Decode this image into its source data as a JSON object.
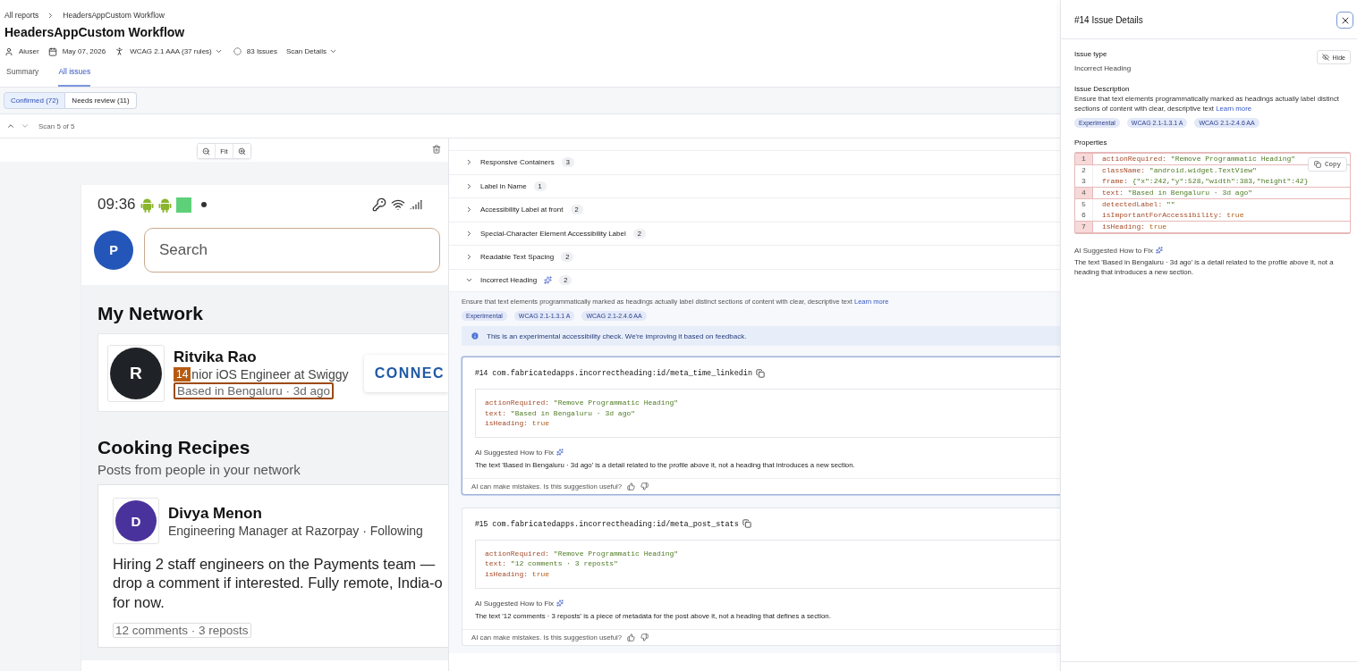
{
  "breadcrumb": [
    {
      "label": "All reports"
    },
    {
      "label": "HeadersAppCustom Workflow"
    }
  ],
  "title": "HeadersAppCustom Workflow",
  "meta": {
    "user": "Aiuser",
    "date": "May 07, 2026",
    "standard": "WCAG 2.1 AAA (37 rules)",
    "issues": "83 Issues",
    "scan_details": "Scan Details"
  },
  "tabs": [
    {
      "label": "Summary",
      "selected": false
    },
    {
      "label": "All issues",
      "selected": true
    }
  ],
  "filters": [
    {
      "label": "Confirmed (72)",
      "selected": true
    },
    {
      "label": "Needs review (11)",
      "selected": false
    }
  ],
  "scan": "Scan 5 of 5",
  "preview": {
    "fit": "Fit",
    "phone": {
      "time": "09:36",
      "avatar": "P",
      "search_placeholder": "Search",
      "network": {
        "heading": "My Network",
        "initial": "R",
        "name": "Ritvika Rao",
        "badge": "14",
        "headline": "nior iOS Engineer at Swiggy",
        "meta": "Based in Bengaluru · 3d ago",
        "highlighted": true,
        "button": "CONNEC"
      },
      "feed": {
        "heading": "Cooking Recipes",
        "subtitle": "Posts from people in your network",
        "initial": "D",
        "name": "Divya Menon",
        "headline": "Engineering Manager at Razorpay · Following",
        "body": "Hiring 2 staff engineers on the Payments team —\ndrop a comment if interested. Fully remote, India-o\nfor now.",
        "stats": "12 comments · 3 reposts",
        "highlighted": false
      }
    }
  },
  "issue_list": {
    "categories": [
      {
        "label": "Responsive Containers",
        "count": "3",
        "expanded": false,
        "ai": false
      },
      {
        "label": "Label in Name",
        "count": "1",
        "expanded": false,
        "ai": false
      },
      {
        "label": "Accessibility Label at front",
        "count": "2",
        "expanded": false,
        "ai": false
      },
      {
        "label": "Special-Character Element Accessibility Label",
        "count": "2",
        "expanded": false,
        "ai": false
      },
      {
        "label": "Readable Text Spacing",
        "count": "2",
        "expanded": false,
        "ai": false
      },
      {
        "label": "Incorrect Heading",
        "count": "2",
        "expanded": true,
        "ai": true
      }
    ],
    "detail": {
      "description": "Ensure that text elements programmatically marked as headings actually label distinct sections of content with clear, descriptive text",
      "learn_more": "Learn more",
      "tags": [
        "Experimental",
        "WCAG 2.1-1.3.1 A",
        "WCAG 2.1-2.4.6 AA"
      ],
      "notice": "This is an experimental accessibility check. We're improving it based on feedback.",
      "issues": [
        {
          "number": "#14",
          "id": "com.fabricatedapps.incorrectheading:id/meta_time_linkedin",
          "selected": true,
          "properties": [
            {
              "key": "actionRequired:",
              "value": "\"Remove Programmatic Heading\"",
              "kind": "string"
            },
            {
              "key": "text:",
              "value": "\"Based in Bengaluru · 3d ago\"",
              "kind": "string"
            },
            {
              "key": "isHeading:",
              "value": "true",
              "kind": "literal"
            }
          ],
          "fix_label": "AI Suggested How to Fix",
          "fix": "The text 'Based in Bengaluru · 3d ago' is a detail related to the profile above it, not a heading that introduces a new section.",
          "feedback": "AI can make mistakes. Is this suggestion useful?"
        },
        {
          "number": "#15",
          "id": "com.fabricatedapps.incorrectheading:id/meta_post_stats",
          "selected": false,
          "properties": [
            {
              "key": "actionRequired:",
              "value": "\"Remove Programmatic Heading\"",
              "kind": "string"
            },
            {
              "key": "text:",
              "value": "\"12 comments · 3 reposts\"",
              "kind": "string"
            },
            {
              "key": "isHeading:",
              "value": "true",
              "kind": "literal"
            }
          ],
          "fix_label": "AI Suggested How to Fix",
          "fix": "The text '12 comments · 3 reposts' is a piece of metadata for the post above it, not a heading that defines a section.",
          "feedback": "AI can make mistakes. Is this suggestion useful?"
        }
      ]
    }
  },
  "drawer": {
    "title": "#14 Issue Details",
    "issue_type_label": "Issue type",
    "issue_type": "Incorrect Heading",
    "hide": "Hide",
    "description_label": "Issue Description",
    "description": "Ensure that text elements programmatically marked as headings actually label distinct sections of content with clear, descriptive text",
    "learn_more": "Learn more",
    "tags": [
      "Experimental",
      "WCAG 2.1-1.3.1 A",
      "WCAG 2.1-2.4.6 AA"
    ],
    "properties_label": "Properties",
    "copy": "Copy",
    "lines": [
      {
        "number": "1",
        "key": "actionRequired:",
        "value": "\"Remove Programmatic Heading\"",
        "kind": "string",
        "flagged": true
      },
      {
        "number": "2",
        "key": "className:",
        "value": "\"android.widget.TextView\"",
        "kind": "string",
        "flagged": false
      },
      {
        "number": "3",
        "key": "frame:",
        "value": "{\"x\":242,\"y\":528,\"width\":383,\"height\":42}",
        "kind": "string",
        "flagged": false
      },
      {
        "number": "4",
        "key": "text:",
        "value": "\"Based in Bengaluru · 3d ago\"",
        "kind": "string",
        "flagged": true
      },
      {
        "number": "5",
        "key": "detectedLabel:",
        "value": "\"\"",
        "kind": "string",
        "flagged": false
      },
      {
        "number": "6",
        "key": "isImportantForAccessibility:",
        "value": "true",
        "kind": "literal",
        "flagged": false
      },
      {
        "number": "7",
        "key": "isHeading:",
        "value": "true",
        "kind": "literal",
        "flagged": true
      }
    ],
    "fix_label": "AI Suggested How to Fix",
    "fix": "The text 'Based in Bengaluru · 3d ago' is a detail related to the profile above it, not a heading that introduces a new section."
  }
}
